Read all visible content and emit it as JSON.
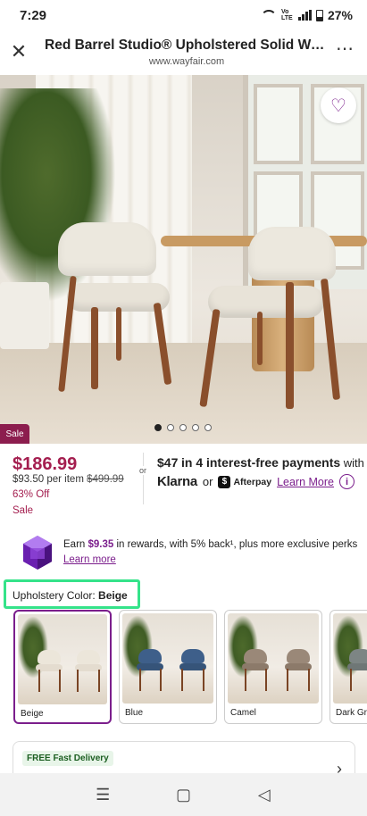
{
  "status": {
    "time": "7:29",
    "battery": "27%",
    "network": "Vo LTE"
  },
  "header": {
    "title": "Red Barrel Studio® Upholstered Solid Wood...",
    "url": "www.wayfair.com",
    "close_icon": "close-icon",
    "more_icon": "more-icon"
  },
  "hero": {
    "sale_tag": "Sale",
    "favorite_icon": "heart-icon",
    "carousel_total": 5,
    "carousel_active": 1
  },
  "pricing": {
    "price": "$186.99",
    "per_item": "$93.50 per item",
    "original_price": "$499.99",
    "discount": "63% Off",
    "sale_label": "Sale",
    "or": "or",
    "installment_amount": "$47",
    "installment_text": "in 4 interest-free payments",
    "with": "with",
    "klarna": "Klarna",
    "or2": "or",
    "afterpay": "Afterpay",
    "learn_more": "Learn More"
  },
  "rewards": {
    "earn": "Earn",
    "amount": "$9.35",
    "rest": "in rewards, with 5% back¹, plus more exclusive perks",
    "learn_more": "Learn more"
  },
  "options": {
    "label": "Upholstery Color:",
    "selected": "Beige",
    "swatches": [
      {
        "label": "Beige",
        "color": "#ece6da"
      },
      {
        "label": "Blue",
        "color": "#3e5f8a"
      },
      {
        "label": "Camel",
        "color": "#9a8878"
      },
      {
        "label": "Dark Gr",
        "color": "#7d8584"
      }
    ]
  },
  "delivery": {
    "badge": "FREE Fast Delivery"
  },
  "colors": {
    "accent": "#7b1e8c",
    "sale": "#a41e4f",
    "highlight": "#35e38a"
  }
}
